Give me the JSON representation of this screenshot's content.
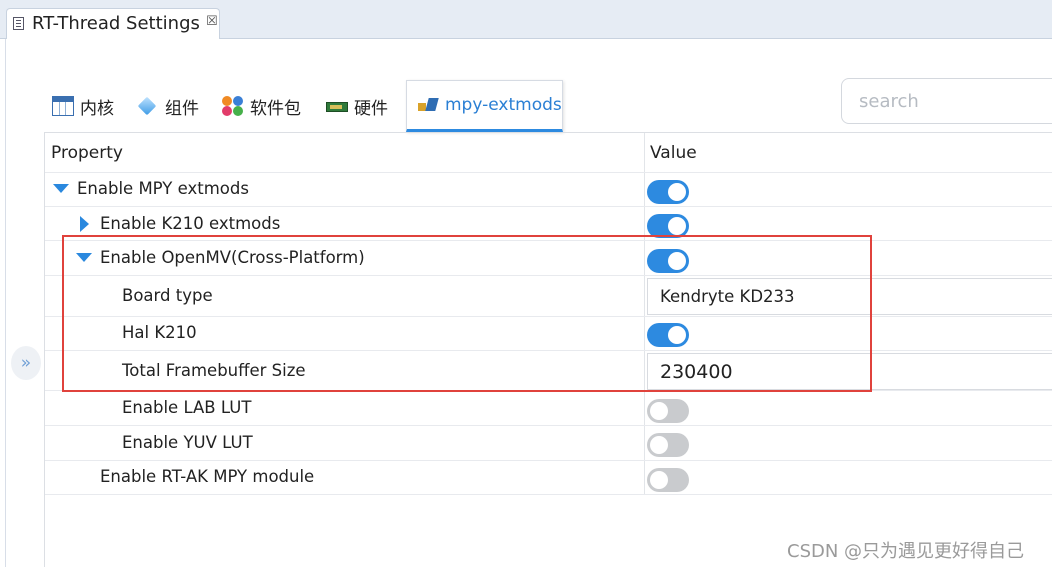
{
  "editor_tab": {
    "title": "RT-Thread Settings",
    "close_glyph": "☒"
  },
  "tabs": [
    {
      "label": "内核",
      "icon": "kernel-table-icon"
    },
    {
      "label": "组件",
      "icon": "component-cube-icon"
    },
    {
      "label": "软件包",
      "icon": "packages-icon"
    },
    {
      "label": "硬件",
      "icon": "hardware-board-icon"
    },
    {
      "label": "mpy-extmods",
      "icon": "mpy-icon",
      "active": true
    }
  ],
  "search": {
    "placeholder": "search",
    "value": ""
  },
  "table": {
    "headers": {
      "property": "Property",
      "value": "Value"
    },
    "rows": [
      {
        "label": "Enable MPY extmods",
        "expander": "expanded",
        "type": "toggle",
        "on": true
      },
      {
        "label": "Enable K210 extmods",
        "expander": "collapsed",
        "type": "toggle",
        "on": true
      },
      {
        "label": "Enable OpenMV(Cross-Platform)",
        "expander": "expanded",
        "type": "toggle",
        "on": true
      },
      {
        "label": "Board type",
        "type": "select",
        "value": "Kendryte KD233"
      },
      {
        "label": "Hal K210",
        "type": "toggle",
        "on": true
      },
      {
        "label": "Total Framebuffer Size",
        "type": "input",
        "value": "230400"
      },
      {
        "label": "Enable LAB LUT",
        "type": "toggle",
        "on": false
      },
      {
        "label": "Enable YUV LUT",
        "type": "toggle",
        "on": false
      },
      {
        "label": "Enable RT-AK MPY module",
        "type": "toggle",
        "on": false
      }
    ]
  },
  "side_button": {
    "glyph": "»"
  },
  "watermark": "CSDN @只为遇见更好得自己",
  "colors": {
    "accent": "#2d8ae0",
    "highlight_box": "#e0423c",
    "toggle_off": "#c9cbce"
  }
}
